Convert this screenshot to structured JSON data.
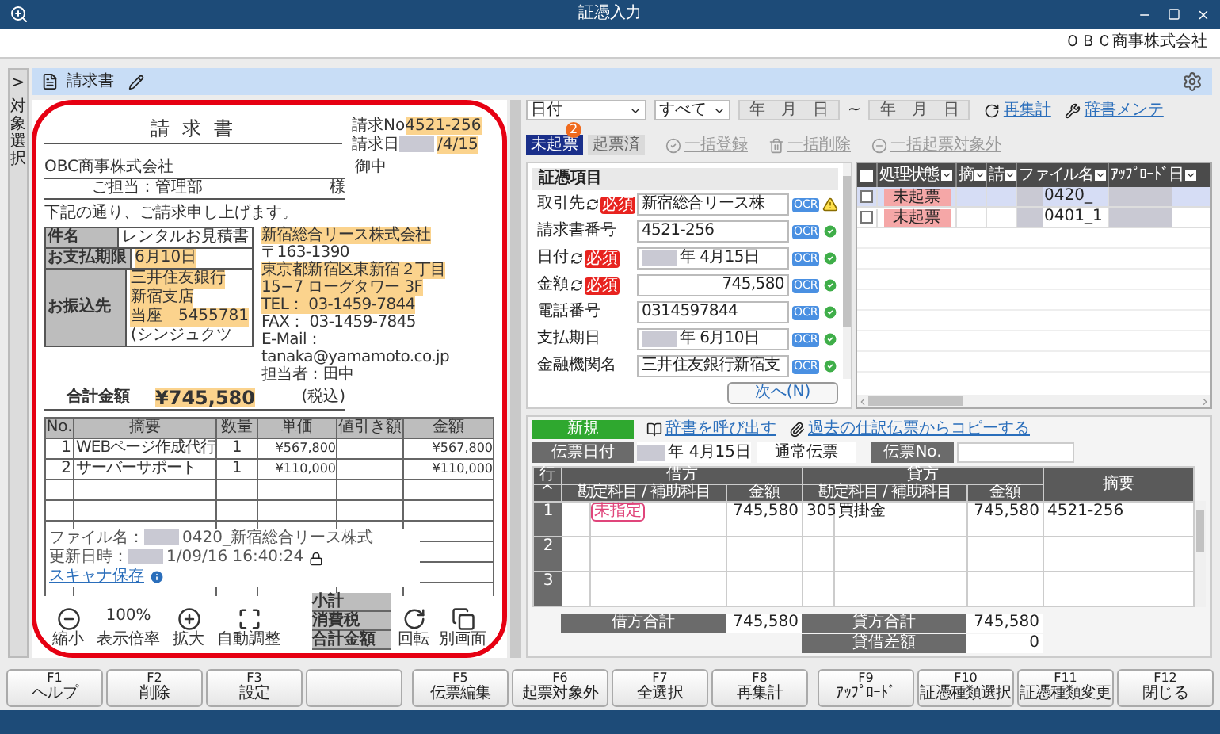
{
  "window": {
    "title": "証憑入力",
    "company": "ＯＢＣ商事株式会社"
  },
  "side_tab": {
    "arrow": ">",
    "label": "対象選択"
  },
  "header": {
    "title": "請求書"
  },
  "viewer": {
    "document": {
      "title": "請 求 書",
      "invoice_no": {
        "label": "請求No",
        "value": "4521-256",
        "highlighted": true
      },
      "invoice_date": {
        "label": "請求日",
        "value": "/4/15",
        "highlighted": true,
        "redacted": true
      },
      "addressee": "OBC商事株式会社",
      "honorific": "御中",
      "attention": "ご担当：管理部",
      "attention_suffix": "様",
      "intro": "下記の通り、ご請求申し上げます。",
      "info": [
        {
          "label": "件名",
          "lines": [
            {
              "text": "レンタルお見積書",
              "highlighted": false
            }
          ]
        },
        {
          "label": "お支払期限",
          "lines": [
            {
              "text": "6月10日",
              "highlighted": true
            }
          ]
        },
        {
          "label": "お振込先",
          "lines": [
            {
              "text": "三井住友銀行",
              "highlighted": true
            },
            {
              "text": "新宿支店",
              "highlighted": true
            },
            {
              "text": "当座　5455781",
              "highlighted": true
            },
            {
              "text": "(シンジュクツ",
              "highlighted": false
            }
          ]
        }
      ],
      "sender": [
        {
          "text": "新宿総合リース株式会社",
          "highlighted": true
        },
        {
          "text": "〒163-1390",
          "highlighted": false
        },
        {
          "text": "東京都新宿区東新宿２丁目",
          "highlighted": true
        },
        {
          "text": "15−7 ローグタワー 3F",
          "highlighted": true
        },
        {
          "text": "TEL： 03-1459-7844",
          "highlighted": true
        },
        {
          "text": "FAX： 03-1459-7845",
          "highlighted": false
        },
        {
          "text": "E-Mail：tanaka@yamamoto.co.jp",
          "highlighted": false
        },
        {
          "text": "担当者：田中",
          "highlighted": false
        }
      ],
      "total_label": "合計金額",
      "total_value": "¥745,580",
      "total_highlighted": true,
      "tax_note": "(税込)",
      "columns": [
        "No.",
        "摘要",
        "数量",
        "単価",
        "値引き額",
        "金額"
      ],
      "items": [
        {
          "no": "1",
          "desc": "WEBページ作成代行",
          "qty": "1",
          "price": "¥567,800",
          "amount": "¥567,800"
        },
        {
          "no": "2",
          "desc": "サーバーサポート",
          "qty": "1",
          "price": "¥110,000",
          "amount": "¥110,000"
        }
      ],
      "summary": [
        "小計",
        "消費税",
        "合計金額"
      ]
    },
    "file_info": {
      "name_label": "ファイル名：",
      "name_value": "0420_新宿総合リース株式",
      "updated_label": "更新日時：",
      "updated_value": "1/09/16 16:40:24",
      "redacted": true,
      "locked": true,
      "link": "スキャナ保存"
    },
    "toolbar": [
      {
        "kind": "zoom-out",
        "label": "縮小"
      },
      {
        "kind": "value",
        "value": "100%",
        "label": "表示倍率"
      },
      {
        "kind": "zoom-in",
        "label": "拡大"
      },
      {
        "kind": "fit",
        "label": "自動調整"
      }
    ],
    "side_tools": [
      {
        "kind": "rotate",
        "label": "回転"
      },
      {
        "kind": "window",
        "label": "別画面"
      }
    ]
  },
  "filters": {
    "field": "日付",
    "scope": "すべて",
    "from": {
      "placeholder": "年　月　日"
    },
    "separator": "~",
    "to": {
      "placeholder": "年　月　日"
    },
    "links": [
      {
        "kind": "refresh",
        "label": "再集計"
      },
      {
        "kind": "tools",
        "label": "辞書メンテ"
      }
    ]
  },
  "status_tabs": [
    {
      "label": "未起票",
      "selected": true,
      "badge": "2"
    },
    {
      "label": "起票済",
      "selected": false
    }
  ],
  "bulk_actions": [
    {
      "kind": "check",
      "label": "一括登録",
      "disabled": true
    },
    {
      "kind": "trash",
      "label": "一括削除",
      "disabled": true
    },
    {
      "kind": "minus",
      "label": "一括起票対象外",
      "disabled": true
    }
  ],
  "form": {
    "title": "証憑項目",
    "fields": [
      {
        "label": "取引先",
        "kind": "text",
        "linked": true,
        "required": "必須",
        "value": "新宿総合リース株",
        "ocr": "OCR",
        "warning": true,
        "redacted": false
      },
      {
        "label": "請求書番号",
        "kind": "text",
        "linked": false,
        "value": "4521-256",
        "ocr": "OCR",
        "warning": false,
        "redacted": false
      },
      {
        "label": "日付",
        "kind": "text",
        "linked": true,
        "required": "必須",
        "value": "年  4月15日",
        "ocr": "OCR",
        "warning": false,
        "redacted": true
      },
      {
        "label": "金額",
        "kind": "amount",
        "linked": true,
        "required": "必須",
        "value": "745,580",
        "ocr": "OCR",
        "warning": false,
        "redacted": false
      },
      {
        "label": "電話番号",
        "kind": "text",
        "linked": false,
        "value": "0314597844",
        "ocr": "OCR",
        "warning": false,
        "redacted": false
      },
      {
        "label": "支払期日",
        "kind": "text",
        "linked": false,
        "value": "年  6月10日",
        "ocr": "OCR",
        "warning": false,
        "redacted": true
      },
      {
        "label": "金融機関名",
        "kind": "text",
        "linked": false,
        "value": "三井住友銀行新宿支",
        "ocr": "OCR",
        "warning": false,
        "redacted": false
      }
    ],
    "next_button": "次へ(N)"
  },
  "grid": {
    "all_checked": false,
    "columns": [
      "処理状態",
      "摘",
      "請",
      "ファイル名",
      "ｱｯﾌﾟﾛｰﾄﾞ日"
    ],
    "rows": [
      {
        "selected": true,
        "checked": false,
        "status": "未起票",
        "file": "0420_"
      },
      {
        "selected": false,
        "checked": false,
        "status": "未起票",
        "file": "0401_1"
      }
    ]
  },
  "journal": {
    "new_button": "新規",
    "links": [
      {
        "kind": "book",
        "label": "辞書を呼び出す"
      },
      {
        "kind": "clip",
        "label": "過去の仕訳伝票からコピーする"
      }
    ],
    "date_label": "伝票日付",
    "date_value": "年  4月15日",
    "date_redacted": true,
    "type": "通常伝票",
    "no_label": "伝票No.",
    "columns": {
      "row": "行",
      "sort": "^",
      "debit": "借方",
      "credit": "貸方",
      "memo": "摘要",
      "debit_account": "勘定科目 / 補助科目",
      "debit_amount": "金額",
      "credit_account": "勘定科目 / 補助科目",
      "credit_amount": "金額"
    },
    "rows": [
      {
        "no": "1",
        "debit_tag": "未指定",
        "debit_amount": "745,580",
        "credit_code": "305",
        "credit_account": "買掛金",
        "credit_amount": "745,580",
        "memo": "4521-256"
      },
      {
        "no": "2"
      },
      {
        "no": "3"
      }
    ],
    "debit_total": {
      "label": "借方合計",
      "value": "745,580"
    },
    "credit_total": {
      "label": "貸方合計",
      "value": "745,580"
    },
    "difference": {
      "label": "貸借差額",
      "value": "0"
    }
  },
  "function_keys": [
    {
      "kind": "key",
      "key": "F1",
      "label": "ヘルプ"
    },
    {
      "kind": "key",
      "key": "F2",
      "label": "削除"
    },
    {
      "kind": "key",
      "key": "F3",
      "label": "設定"
    },
    {
      "kind": "blank"
    },
    {
      "kind": "key",
      "key": "F5",
      "label": "伝票編集"
    },
    {
      "kind": "key",
      "key": "F6",
      "label": "起票対象外"
    },
    {
      "kind": "key",
      "key": "F7",
      "label": "全選択"
    },
    {
      "kind": "key",
      "key": "F8",
      "label": "再集計"
    },
    {
      "kind": "key",
      "key": "F9",
      "label": "ｱｯﾌﾟﾛｰﾄﾞ"
    },
    {
      "kind": "key",
      "key": "F10",
      "label": "証憑種類選択"
    },
    {
      "kind": "key",
      "key": "F11",
      "label": "証憑種類変更"
    },
    {
      "kind": "key",
      "key": "F12",
      "label": "閉じる"
    }
  ]
}
